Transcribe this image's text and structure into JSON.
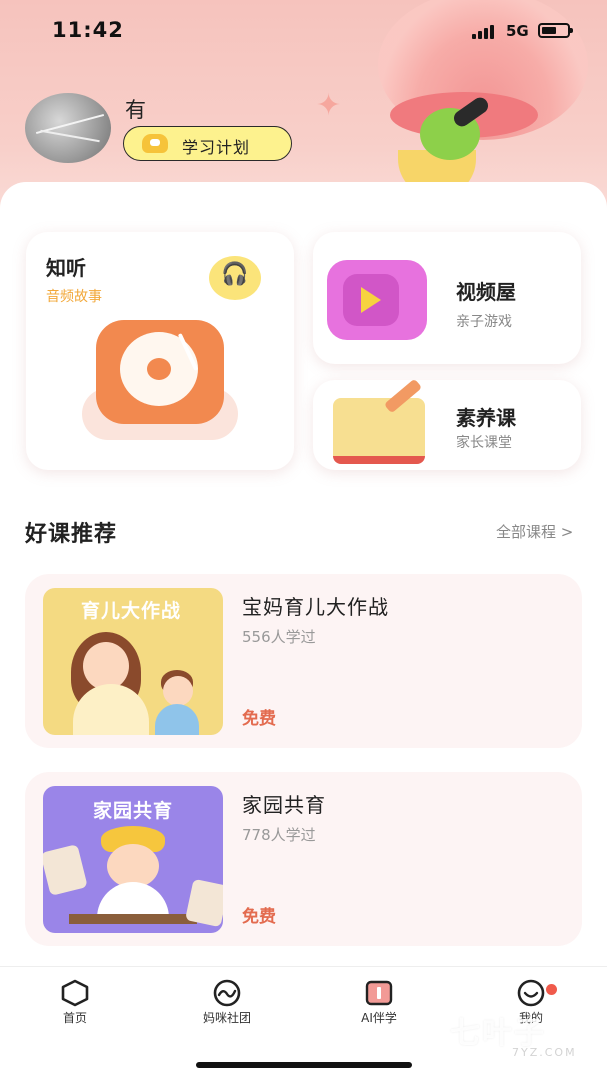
{
  "status_bar": {
    "time": "11:42",
    "network": "5G"
  },
  "profile": {
    "name": "有",
    "plan_button": "学习计划"
  },
  "features": {
    "audio": {
      "title": "知听",
      "subtitle": "音频故事"
    },
    "video": {
      "title": "视频屋",
      "subtitle": "亲子游戏"
    },
    "course": {
      "title": "素养课",
      "subtitle": "家长课堂"
    }
  },
  "recommend": {
    "title": "好课推荐",
    "more": "全部课程 >",
    "courses": [
      {
        "thumb_label": "育儿大作战",
        "name": "宝妈育儿大作战",
        "learners": "556人学过",
        "price": "免费"
      },
      {
        "thumb_label": "家园共育",
        "name": "家园共育",
        "learners": "778人学过",
        "price": "免费"
      }
    ]
  },
  "tabbar": {
    "items": [
      {
        "label": "首页",
        "icon": "home-hexagon-icon"
      },
      {
        "label": "妈咪社团",
        "icon": "wave-circle-icon"
      },
      {
        "label": "AI伴学",
        "icon": "ai-box-icon"
      },
      {
        "label": "我的",
        "icon": "smile-icon"
      }
    ]
  },
  "watermark": {
    "text": "七叶子",
    "sub": "7YZ.COM"
  },
  "colors": {
    "accent": "#f2894f",
    "price": "#e36b4f",
    "hero": "#f6c3bd",
    "badge": "#f05a4b"
  }
}
